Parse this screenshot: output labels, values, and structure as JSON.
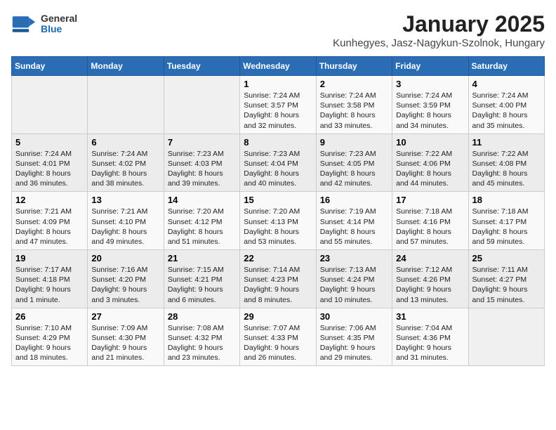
{
  "header": {
    "logo_general": "General",
    "logo_blue": "Blue",
    "month_title": "January 2025",
    "location": "Kunhegyes, Jasz-Nagykun-Szolnok, Hungary"
  },
  "weekdays": [
    "Sunday",
    "Monday",
    "Tuesday",
    "Wednesday",
    "Thursday",
    "Friday",
    "Saturday"
  ],
  "weeks": [
    [
      {
        "day": "",
        "text": ""
      },
      {
        "day": "",
        "text": ""
      },
      {
        "day": "",
        "text": ""
      },
      {
        "day": "1",
        "text": "Sunrise: 7:24 AM\nSunset: 3:57 PM\nDaylight: 8 hours and 32 minutes."
      },
      {
        "day": "2",
        "text": "Sunrise: 7:24 AM\nSunset: 3:58 PM\nDaylight: 8 hours and 33 minutes."
      },
      {
        "day": "3",
        "text": "Sunrise: 7:24 AM\nSunset: 3:59 PM\nDaylight: 8 hours and 34 minutes."
      },
      {
        "day": "4",
        "text": "Sunrise: 7:24 AM\nSunset: 4:00 PM\nDaylight: 8 hours and 35 minutes."
      }
    ],
    [
      {
        "day": "5",
        "text": "Sunrise: 7:24 AM\nSunset: 4:01 PM\nDaylight: 8 hours and 36 minutes."
      },
      {
        "day": "6",
        "text": "Sunrise: 7:24 AM\nSunset: 4:02 PM\nDaylight: 8 hours and 38 minutes."
      },
      {
        "day": "7",
        "text": "Sunrise: 7:23 AM\nSunset: 4:03 PM\nDaylight: 8 hours and 39 minutes."
      },
      {
        "day": "8",
        "text": "Sunrise: 7:23 AM\nSunset: 4:04 PM\nDaylight: 8 hours and 40 minutes."
      },
      {
        "day": "9",
        "text": "Sunrise: 7:23 AM\nSunset: 4:05 PM\nDaylight: 8 hours and 42 minutes."
      },
      {
        "day": "10",
        "text": "Sunrise: 7:22 AM\nSunset: 4:06 PM\nDaylight: 8 hours and 44 minutes."
      },
      {
        "day": "11",
        "text": "Sunrise: 7:22 AM\nSunset: 4:08 PM\nDaylight: 8 hours and 45 minutes."
      }
    ],
    [
      {
        "day": "12",
        "text": "Sunrise: 7:21 AM\nSunset: 4:09 PM\nDaylight: 8 hours and 47 minutes."
      },
      {
        "day": "13",
        "text": "Sunrise: 7:21 AM\nSunset: 4:10 PM\nDaylight: 8 hours and 49 minutes."
      },
      {
        "day": "14",
        "text": "Sunrise: 7:20 AM\nSunset: 4:12 PM\nDaylight: 8 hours and 51 minutes."
      },
      {
        "day": "15",
        "text": "Sunrise: 7:20 AM\nSunset: 4:13 PM\nDaylight: 8 hours and 53 minutes."
      },
      {
        "day": "16",
        "text": "Sunrise: 7:19 AM\nSunset: 4:14 PM\nDaylight: 8 hours and 55 minutes."
      },
      {
        "day": "17",
        "text": "Sunrise: 7:18 AM\nSunset: 4:16 PM\nDaylight: 8 hours and 57 minutes."
      },
      {
        "day": "18",
        "text": "Sunrise: 7:18 AM\nSunset: 4:17 PM\nDaylight: 8 hours and 59 minutes."
      }
    ],
    [
      {
        "day": "19",
        "text": "Sunrise: 7:17 AM\nSunset: 4:18 PM\nDaylight: 9 hours and 1 minute."
      },
      {
        "day": "20",
        "text": "Sunrise: 7:16 AM\nSunset: 4:20 PM\nDaylight: 9 hours and 3 minutes."
      },
      {
        "day": "21",
        "text": "Sunrise: 7:15 AM\nSunset: 4:21 PM\nDaylight: 9 hours and 6 minutes."
      },
      {
        "day": "22",
        "text": "Sunrise: 7:14 AM\nSunset: 4:23 PM\nDaylight: 9 hours and 8 minutes."
      },
      {
        "day": "23",
        "text": "Sunrise: 7:13 AM\nSunset: 4:24 PM\nDaylight: 9 hours and 10 minutes."
      },
      {
        "day": "24",
        "text": "Sunrise: 7:12 AM\nSunset: 4:26 PM\nDaylight: 9 hours and 13 minutes."
      },
      {
        "day": "25",
        "text": "Sunrise: 7:11 AM\nSunset: 4:27 PM\nDaylight: 9 hours and 15 minutes."
      }
    ],
    [
      {
        "day": "26",
        "text": "Sunrise: 7:10 AM\nSunset: 4:29 PM\nDaylight: 9 hours and 18 minutes."
      },
      {
        "day": "27",
        "text": "Sunrise: 7:09 AM\nSunset: 4:30 PM\nDaylight: 9 hours and 21 minutes."
      },
      {
        "day": "28",
        "text": "Sunrise: 7:08 AM\nSunset: 4:32 PM\nDaylight: 9 hours and 23 minutes."
      },
      {
        "day": "29",
        "text": "Sunrise: 7:07 AM\nSunset: 4:33 PM\nDaylight: 9 hours and 26 minutes."
      },
      {
        "day": "30",
        "text": "Sunrise: 7:06 AM\nSunset: 4:35 PM\nDaylight: 9 hours and 29 minutes."
      },
      {
        "day": "31",
        "text": "Sunrise: 7:04 AM\nSunset: 4:36 PM\nDaylight: 9 hours and 31 minutes."
      },
      {
        "day": "",
        "text": ""
      }
    ]
  ]
}
